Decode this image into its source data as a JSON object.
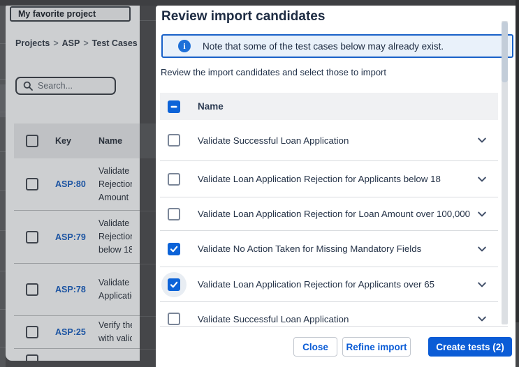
{
  "background_page": {
    "project_selector_label": "My favorite project",
    "breadcrumb": [
      "Projects",
      "ASP",
      "Test Cases"
    ],
    "breadcrumb_separator": ">",
    "search_placeholder": "Search...",
    "table": {
      "columns": [
        "Key",
        "Name"
      ],
      "rows": [
        {
          "key": "ASP:80",
          "name_lines": [
            "Validate",
            "Rejection",
            "Amount"
          ]
        },
        {
          "key": "ASP:79",
          "name_lines": [
            "Validate",
            "Rejection",
            "below 18"
          ]
        },
        {
          "key": "ASP:78",
          "name_lines": [
            "Validate",
            "Application"
          ]
        },
        {
          "key": "ASP:25",
          "name_lines": [
            "Verify the",
            "with valid"
          ]
        }
      ]
    }
  },
  "modal": {
    "title": "Review import candidates",
    "note": "Note that some of the test cases below may already exist.",
    "info_icon_glyph": "i",
    "instruction": "Review the import candidates and select those to import",
    "list_header": "Name",
    "header_checkbox_state": "indeterminate",
    "rows": [
      {
        "label": "Validate Successful Loan Application",
        "checked": false,
        "focused": false
      },
      {
        "label": "Validate Loan Application Rejection for Applicants below 18",
        "checked": false,
        "focused": false
      },
      {
        "label": "Validate Loan Application Rejection for Loan Amount over 100,000",
        "checked": false,
        "focused": false
      },
      {
        "label": "Validate No Action Taken for Missing Mandatory Fields",
        "checked": true,
        "focused": false
      },
      {
        "label": "Validate Loan Application Rejection for Applicants over 65",
        "checked": true,
        "focused": true
      },
      {
        "label": "Validate Successful Loan Application",
        "checked": false,
        "focused": false
      }
    ],
    "selected_count": 2,
    "buttons": {
      "close": "Close",
      "refine": "Refine import",
      "create": "Create tests (2)"
    },
    "colors": {
      "accent_blue": "#0b5cd6",
      "checkbox_blue": "#0c63d8",
      "banner_border": "#1961c8",
      "banner_bg": "#e9f1fa"
    }
  }
}
